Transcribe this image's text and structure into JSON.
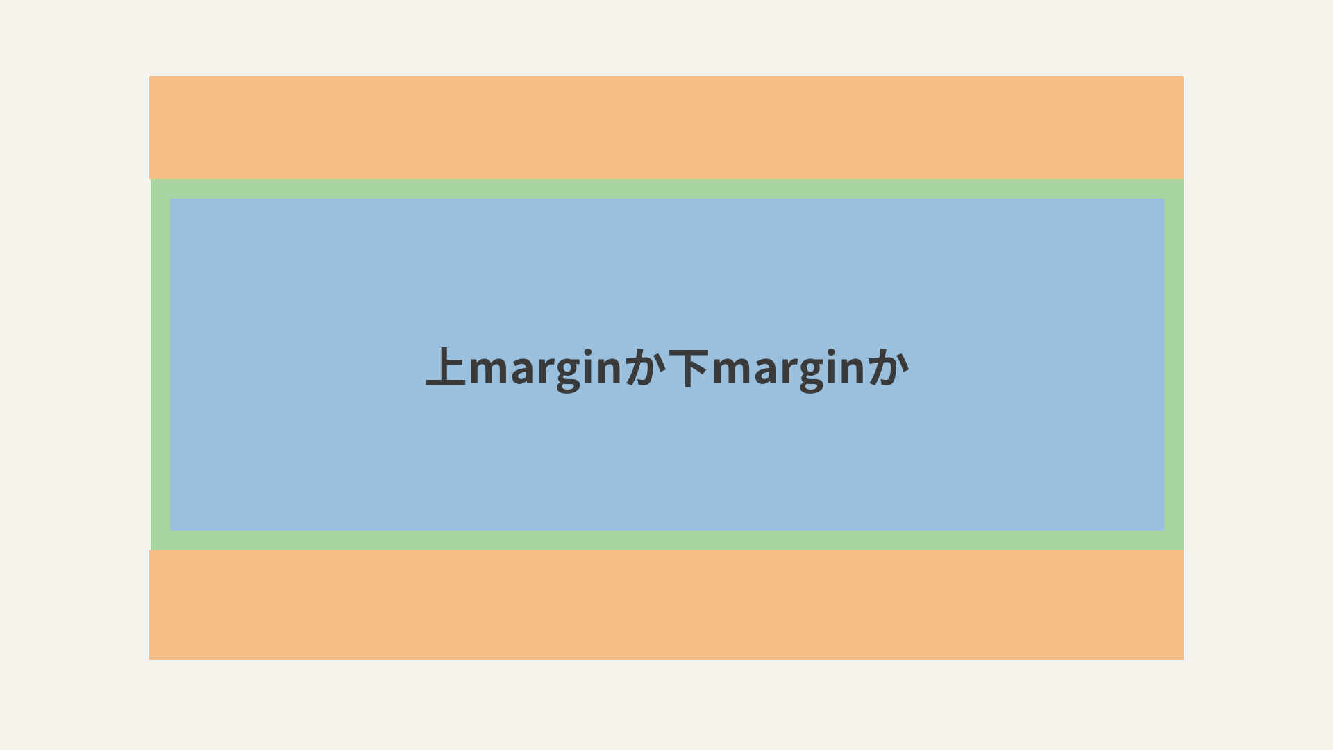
{
  "diagram": {
    "content_text": "上marginか下marginか"
  },
  "colors": {
    "background": "#f5f3ec",
    "margin": "#f3bd84",
    "padding": "#a7d4a0",
    "content": "#9bc0de",
    "text": "#3a3a3a"
  }
}
